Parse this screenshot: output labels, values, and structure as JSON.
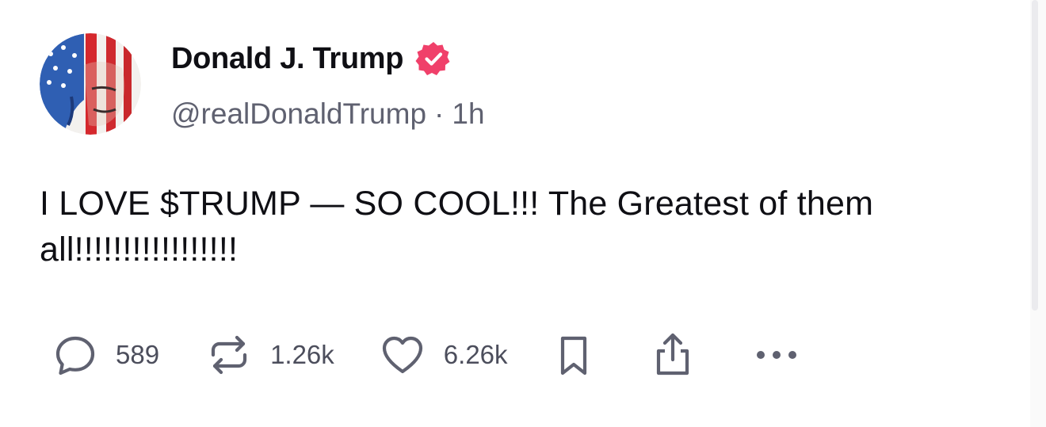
{
  "author": {
    "display_name": "Donald J. Trump",
    "handle": "@realDonaldTrump",
    "separator": "·",
    "time_ago": "1h",
    "verified_icon": "verified-badge-icon",
    "verified_color": "#f0406a"
  },
  "post": {
    "text": "I LOVE $TRUMP — SO COOL!!! The Greatest of them all!!!!!!!!!!!!!!!!!"
  },
  "actions": {
    "replies": "589",
    "reposts": "1.26k",
    "likes": "6.26k"
  },
  "icons": {
    "reply": "comment-bubble-icon",
    "repost": "repost-arrows-icon",
    "like": "heart-icon",
    "bookmark": "bookmark-icon",
    "share": "share-upload-icon",
    "more": "more-dots-icon"
  },
  "colors": {
    "text": "#0f0f14",
    "muted": "#5f6170",
    "icon": "#5f6170",
    "accent": "#f0406a"
  }
}
